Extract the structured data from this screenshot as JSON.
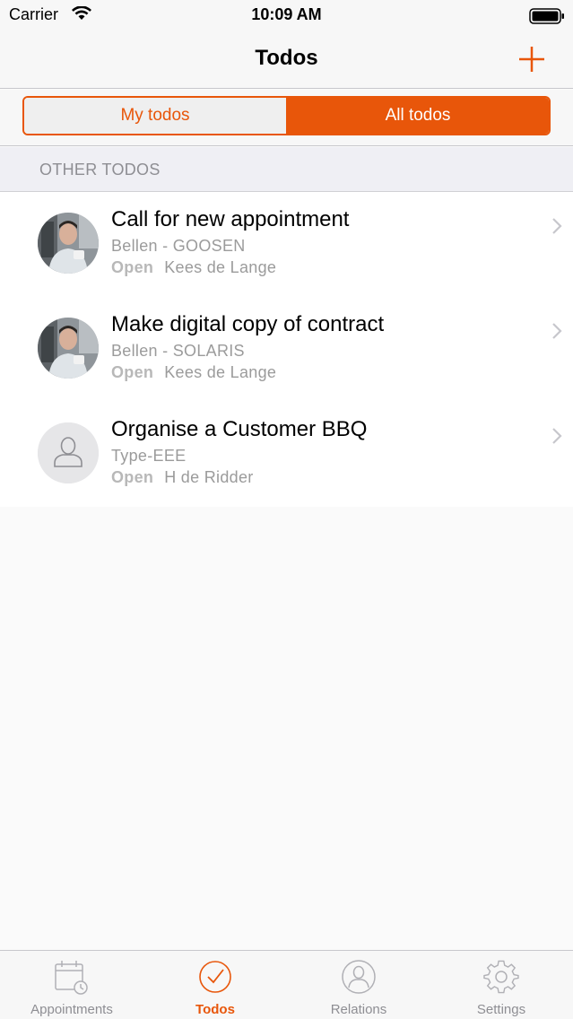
{
  "status_bar": {
    "carrier": "Carrier",
    "time": "10:09 AM"
  },
  "nav": {
    "title": "Todos"
  },
  "segments": {
    "left": "My todos",
    "right": "All todos",
    "selected": "All todos"
  },
  "section": {
    "title": "OTHER TODOS"
  },
  "todos": [
    {
      "title": "Call for new appointment",
      "subtitle": "Bellen - GOOSEN",
      "status": "Open",
      "owner": "Kees de Lange",
      "avatar": "photo"
    },
    {
      "title": "Make digital copy of contract",
      "subtitle": "Bellen - SOLARIS",
      "status": "Open",
      "owner": "Kees de Lange",
      "avatar": "photo"
    },
    {
      "title": "Organise a Customer BBQ",
      "subtitle": "Type-EEE",
      "status": "Open",
      "owner": "H de Ridder",
      "avatar": "placeholder"
    }
  ],
  "tabs": [
    {
      "label": "Appointments",
      "icon": "calendar-clock-icon"
    },
    {
      "label": "Todos",
      "icon": "checkmark-circle-icon"
    },
    {
      "label": "Relations",
      "icon": "person-circle-icon"
    },
    {
      "label": "Settings",
      "icon": "gear-icon"
    }
  ],
  "active_tab": "Todos",
  "colors": {
    "accent": "#e8560a",
    "secondary_text": "#9b9b9b",
    "status_text": "#b8b8b8"
  }
}
